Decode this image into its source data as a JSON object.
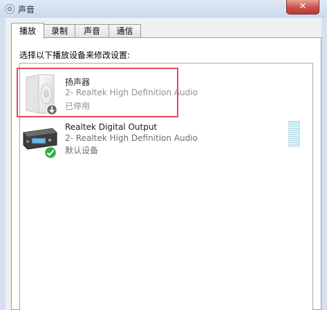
{
  "window": {
    "title": "声音",
    "close_label": "✕"
  },
  "tabs": [
    {
      "label": "播放",
      "active": true
    },
    {
      "label": "录制",
      "active": false
    },
    {
      "label": "声音",
      "active": false
    },
    {
      "label": "通信",
      "active": false
    }
  ],
  "instruction": "选择以下播放设备来修改设置:",
  "devices": [
    {
      "name": "扬声器",
      "driver": "2- Realtek High Definition Audio",
      "status": "已停用",
      "icon": "speaker-icon",
      "badge": "disabled-down-arrow-icon",
      "highlighted": true
    },
    {
      "name": "Realtek Digital Output",
      "driver": "2- Realtek High Definition Audio",
      "status": "默认设备",
      "icon": "digital-output-device-icon",
      "badge": "default-check-icon",
      "highlighted": false
    }
  ],
  "colors": {
    "highlight": "#e04b56",
    "titlebar": "#c9d9ec",
    "check": "#2fae3a"
  }
}
